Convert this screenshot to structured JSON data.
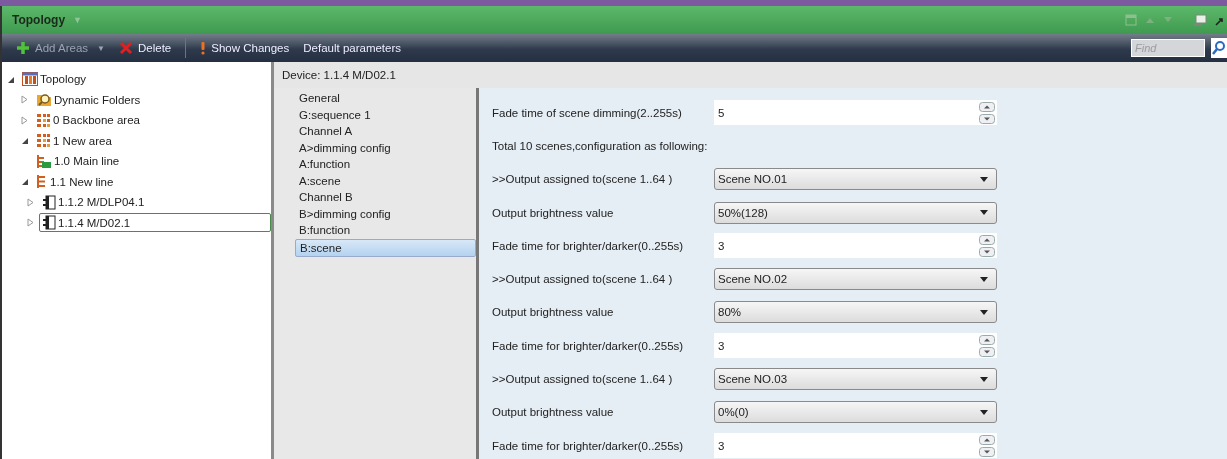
{
  "title_bar": {
    "title": "Topology",
    "caret": "▼"
  },
  "toolbar": {
    "items": [
      {
        "kind": "add",
        "label": "Add Areas",
        "disabled": true,
        "caret": "▼"
      },
      {
        "kind": "delete",
        "label": "Delete",
        "disabled": false
      },
      {
        "kind": "changes",
        "label": "Show Changes",
        "disabled": false
      },
      {
        "kind": "plain",
        "label": "Default parameters",
        "disabled": false
      }
    ],
    "search": {
      "placeholder": "Find"
    }
  },
  "tree": [
    {
      "kind": "topology",
      "label": "Topology",
      "expanded": true,
      "selected": false,
      "children": [
        {
          "kind": "folder",
          "label": "Dynamic Folders",
          "expanded": false,
          "selected": false
        },
        {
          "kind": "area",
          "label": "0 Backbone area",
          "expanded": false,
          "selected": false
        },
        {
          "kind": "area",
          "label": "1 New area",
          "expanded": true,
          "selected": false,
          "children": [
            {
              "kind": "mainline",
              "label": "1.0 Main line",
              "selected": false
            },
            {
              "kind": "line",
              "label": "1.1 New line",
              "expanded": true,
              "selected": false,
              "children": [
                {
                  "kind": "device",
                  "label": "1.1.2  M/DLP04.1",
                  "expanded": false,
                  "selected": false
                },
                {
                  "kind": "device",
                  "label": "1.1.4  M/D02.1",
                  "expanded": false,
                  "selected": true
                }
              ]
            }
          ]
        }
      ]
    }
  ],
  "device": {
    "title": "Device: 1.1.4  M/D02.1",
    "pages": [
      {
        "label": "General",
        "selected": false
      },
      {
        "label": "G:sequence 1",
        "selected": false
      },
      {
        "label": "Channel A",
        "selected": false
      },
      {
        "label": "A>dimming config",
        "selected": false
      },
      {
        "label": "A:function",
        "selected": false
      },
      {
        "label": "A:scene",
        "selected": false
      },
      {
        "label": "Channel B",
        "selected": false
      },
      {
        "label": "B>dimming config",
        "selected": false
      },
      {
        "label": "B:function",
        "selected": false
      },
      {
        "label": "B:scene",
        "selected": true
      }
    ]
  },
  "parameters": [
    {
      "kind": "spin",
      "label": "Fade time of scene dimming(2..255s)",
      "value": "5"
    },
    {
      "kind": "note",
      "label": "Total 10 scenes,configuration as following:"
    },
    {
      "kind": "dropdown",
      "label": ">>Output assigned to(scene 1..64 )",
      "value": "Scene NO.01"
    },
    {
      "kind": "dropdown",
      "label": "Output brightness value",
      "value": "50%(128)"
    },
    {
      "kind": "spin",
      "label": "Fade time for brighter/darker(0..255s)",
      "value": "3"
    },
    {
      "kind": "dropdown",
      "label": ">>Output assigned to(scene 1..64 )",
      "value": "Scene NO.02"
    },
    {
      "kind": "dropdown",
      "label": "Output brightness value",
      "value": "80%"
    },
    {
      "kind": "spin",
      "label": "Fade time for brighter/darker(0..255s)",
      "value": "3"
    },
    {
      "kind": "dropdown",
      "label": ">>Output assigned to(scene 1..64 )",
      "value": "Scene NO.03"
    },
    {
      "kind": "dropdown",
      "label": "Output brightness value",
      "value": "0%(0)"
    },
    {
      "kind": "spin",
      "label": "Fade time for brighter/darker(0..255s)",
      "value": "3"
    }
  ]
}
